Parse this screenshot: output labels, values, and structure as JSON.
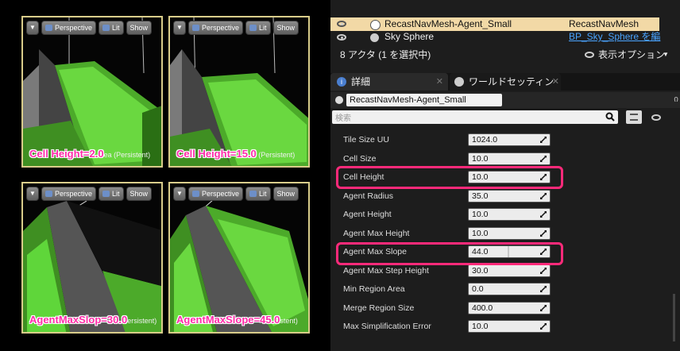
{
  "viewports": [
    {
      "btn_perspective": "Perspective",
      "btn_lit": "Lit",
      "btn_show": "Show",
      "label": "Cell Height=2.0",
      "sub": "ea (Persistent)"
    },
    {
      "btn_perspective": "Perspective",
      "btn_lit": "Lit",
      "btn_show": "Show",
      "label": "Cell Height=15.0",
      "sub": " (Persistent)"
    },
    {
      "btn_perspective": "Perspective",
      "btn_lit": "Lit",
      "btn_show": "Show",
      "label": "AgentMaxSlop=30.0",
      "sub": "ersistent)"
    },
    {
      "btn_perspective": "Perspective",
      "btn_lit": "Lit",
      "btn_show": "Show",
      "label": "AgentMaxSlope=45.0",
      "sub": "stent)"
    }
  ],
  "outliner": {
    "rows": [
      {
        "name": "RecastNavMesh-Agent_Small",
        "type": "RecastNavMesh"
      },
      {
        "name": "Sky Sphere",
        "type": "BP_Sky_Sphere を編"
      }
    ],
    "count_text": "8 アクタ (1 を選択中)",
    "view_options": "表示オプション"
  },
  "tabs": {
    "details": "詳細",
    "world": "ワールドセッティン"
  },
  "details": {
    "actor_name": "RecastNavMesh-Agent_Small",
    "search_placeholder": "検索",
    "properties": [
      {
        "label": "Tile Size UU",
        "value": "1024.0"
      },
      {
        "label": "Cell Size",
        "value": "10.0"
      },
      {
        "label": "Cell Height",
        "value": "10.0"
      },
      {
        "label": "Agent Radius",
        "value": "35.0"
      },
      {
        "label": "Agent Height",
        "value": "10.0"
      },
      {
        "label": "Agent Max Height",
        "value": "10.0"
      },
      {
        "label": "Agent Max Slope",
        "value": "44.0"
      },
      {
        "label": "Agent Max Step Height",
        "value": "30.0"
      },
      {
        "label": "Min Region Area",
        "value": "0.0"
      },
      {
        "label": "Merge Region Size",
        "value": "400.0"
      },
      {
        "label": "Max Simplification Error",
        "value": "10.0"
      }
    ]
  },
  "colors": {
    "highlight": "#ff2a7a",
    "navmesh": "#5fd63a",
    "label": "#ff2aa8",
    "selected_row": "#f2d9a6"
  }
}
